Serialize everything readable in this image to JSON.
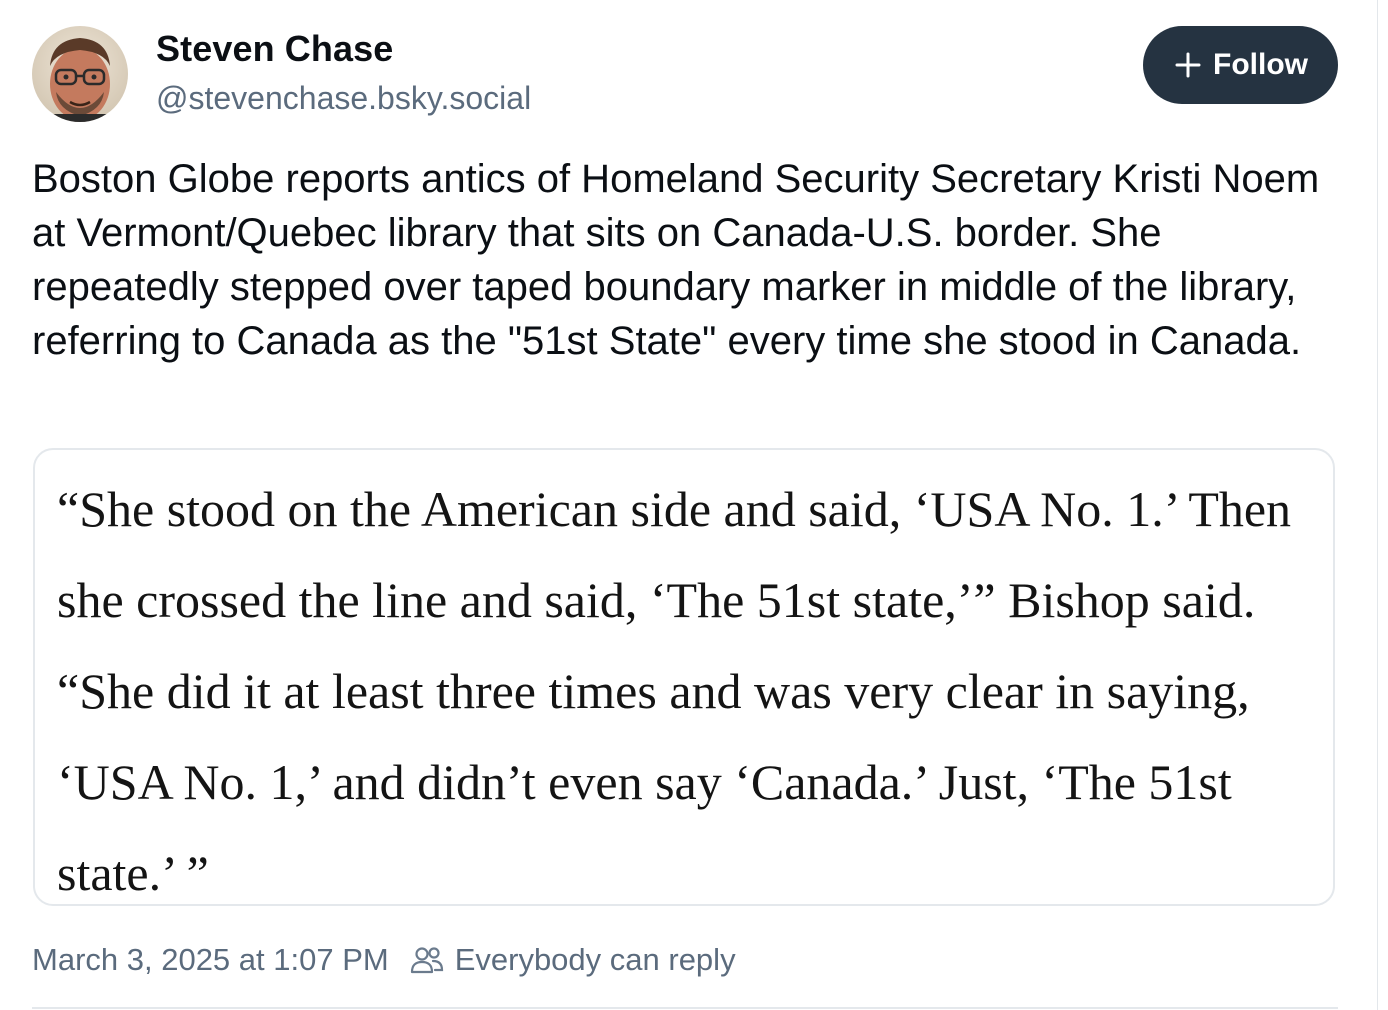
{
  "author": {
    "name": "Steven Chase",
    "handle": "@stevenchase.bsky.social",
    "avatar_icon": "user-avatar-photo"
  },
  "follow_button": {
    "label": "Follow",
    "icon": "plus-icon",
    "color": "#253341"
  },
  "post": {
    "text": "Boston Globe reports antics of Homeland Security Secretary Kristi Noem at Vermont/Quebec library that sits on Canada-U.S. border. She repeatedly stepped over taped boundary marker in middle of the library, referring to Canada as the \"51st State\" every time she stood in Canada."
  },
  "quote_image": {
    "text": "“She stood on the American side and said, ‘USA No. 1.’ Then she crossed the line and said, ‘The 51st state,’” Bishop said. “She did it at least three times and was very clear in saying, ‘USA No. 1,’ and didn’t even say ‘Canada.’ Just, ‘The 51st state.’ ”"
  },
  "meta": {
    "timestamp": "March 3, 2025 at 1:07 PM",
    "reply_setting": "Everybody can reply",
    "reply_icon": "people-icon"
  }
}
